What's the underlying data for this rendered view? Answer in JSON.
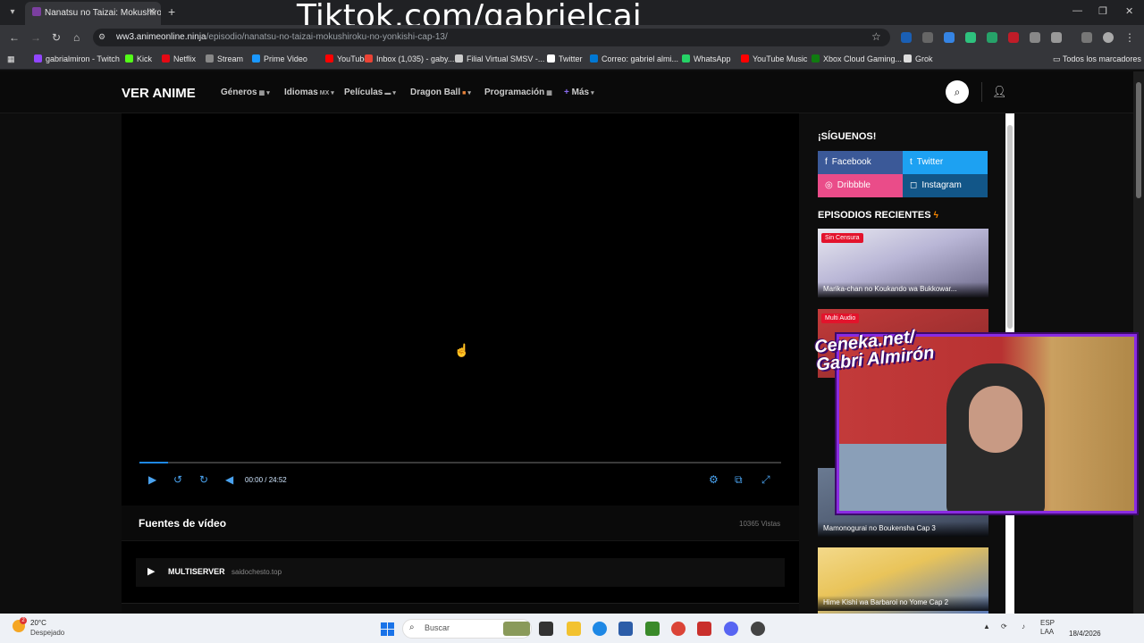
{
  "browser": {
    "tab_title": "Nanatsu no Taizai: Mokushiroku",
    "url_host": "ww3.animeonline.ninja",
    "url_path": "/episodio/nanatsu-no-taizai-mokushiroku-no-yonkishi-cap-13/",
    "overlay_text": "Tiktok.com/gabrielcai_",
    "bookmarks": [
      {
        "label": "gabrialmiron - Twitch",
        "color": "#9146ff"
      },
      {
        "label": "Kick",
        "color": "#53fc18"
      },
      {
        "label": "Netflix",
        "color": "#e50914"
      },
      {
        "label": "Stream",
        "color": "#888888"
      },
      {
        "label": "Prime Video",
        "color": "#1a98ff"
      },
      {
        "label": "YouTube",
        "color": "#ff0000"
      },
      {
        "label": "Inbox (1,035) - gaby...",
        "color": "#ea4335"
      },
      {
        "label": "Filial Virtual SMSV -...",
        "color": "#cccccc"
      },
      {
        "label": "Twitter",
        "color": "#ffffff"
      },
      {
        "label": "Correo: gabriel almi...",
        "color": "#0078d4"
      },
      {
        "label": "WhatsApp",
        "color": "#25d366"
      },
      {
        "label": "YouTube Music",
        "color": "#ff0000"
      },
      {
        "label": "Xbox Cloud Gaming...",
        "color": "#107c10"
      },
      {
        "label": "Grok",
        "color": "#dddddd"
      }
    ],
    "all_bookmarks": "Todos los marcadores"
  },
  "site": {
    "logo": "VER ANIME",
    "nav": [
      {
        "label": "Géneros",
        "tag": "▦"
      },
      {
        "label": "Idiomas",
        "tag": "MX"
      },
      {
        "label": "Películas",
        "tag": "▬"
      },
      {
        "label": "Dragon Ball",
        "tag": "■"
      },
      {
        "label": "Programación",
        "tag": "▦"
      },
      {
        "label": "Más",
        "tag": ""
      }
    ]
  },
  "player": {
    "current_time": "00:00",
    "separator": "/",
    "duration": "24:52",
    "progress": 0.045
  },
  "sources": {
    "title": "Fuentes de vídeo",
    "views": "10365 Vistas",
    "servers": [
      {
        "name": "MULTISERVER",
        "host": "saidochesto.top"
      }
    ]
  },
  "sidebar": {
    "follow_title": "¡SÍGUENOS!",
    "socials": [
      {
        "label": "Facebook",
        "icon": "f",
        "color": "#3b5998"
      },
      {
        "label": "Twitter",
        "icon": "t",
        "color": "#1da1f2"
      },
      {
        "label": "Dribbble",
        "icon": "◎",
        "color": "#ea4c89"
      },
      {
        "label": "Instagram",
        "icon": "◻",
        "color": "#125688"
      }
    ],
    "recent_title": "EPISODIOS RECIENTES",
    "episodes": [
      {
        "badge": "Sin Censura",
        "title": "Marika-chan no Koukando wa Bukkowar..."
      },
      {
        "badge": "Multi Audio",
        "title": ""
      },
      {
        "badge": "",
        "title": "Mamonogurai no Boukensha Cap 3"
      },
      {
        "badge": "",
        "title": "Hime Kishi wa Barbaroi no Yome Cap 2"
      }
    ]
  },
  "webcam": {
    "label_line1": "Ceneka.net/",
    "label_line2": "Gabri Almirón"
  },
  "taskbar": {
    "temperature": "20°C",
    "condition": "Despejado",
    "weather_badge": "2",
    "search_placeholder": "Buscar",
    "lang": "ESP",
    "lang_sub": "LAA",
    "date": "18/4/2026"
  }
}
